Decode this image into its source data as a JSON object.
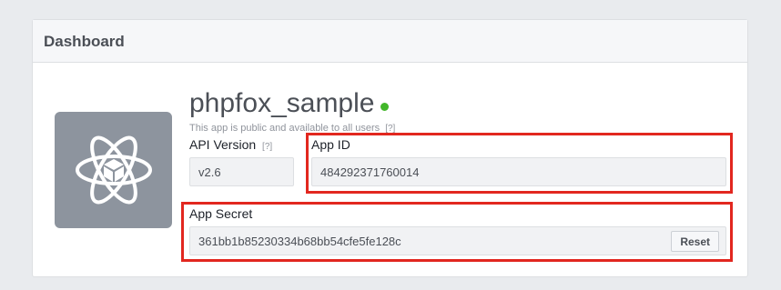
{
  "panel": {
    "title": "Dashboard"
  },
  "app": {
    "name": "phpfox_sample",
    "status_color": "#42b72a",
    "description": "This app is public and available to all users",
    "description_help": "[?]",
    "icon": "atom-cube-icon"
  },
  "fields": {
    "api_version": {
      "label": "API Version",
      "help": "[?]",
      "value": "v2.6"
    },
    "app_id": {
      "label": "App ID",
      "value": "484292371760014"
    },
    "app_secret": {
      "label": "App Secret",
      "value": "361bb1b85230334b68bb54cfe5fe128c",
      "reset_label": "Reset"
    }
  },
  "highlight_color": "#e2271f"
}
